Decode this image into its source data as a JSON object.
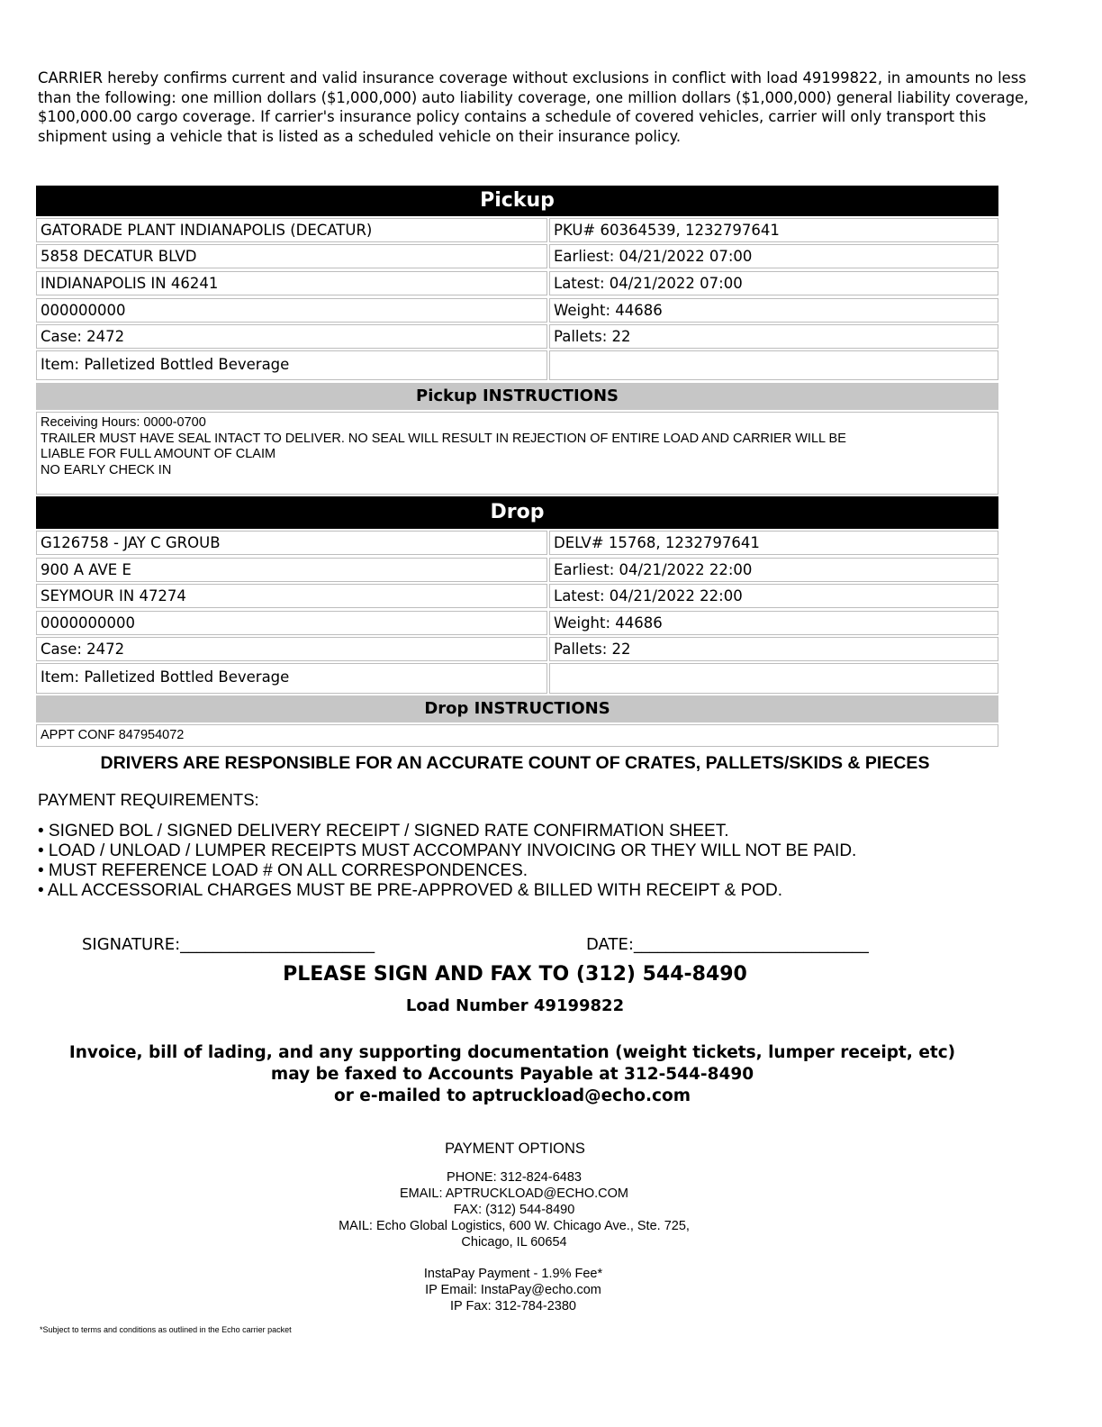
{
  "intro": [
    "CARRIER hereby confirms current and valid insurance coverage without exclusions in conflict with load 49199822, in amounts no less",
    "than the following: one million dollars ($1,000,000) auto liability coverage, one million dollars ($1,000,000) general liability coverage,",
    "$100,000.00 cargo coverage. If carrier's insurance policy contains a schedule of covered vehicles, carrier will only transport this",
    "shipment using a vehicle that is listed as a scheduled vehicle on their insurance policy."
  ],
  "pickup": {
    "title": "Pickup",
    "left": [
      "GATORADE PLANT INDIANAPOLIS (DECATUR)",
      "5858 DECATUR BLVD",
      "INDIANAPOLIS IN 46241",
      "000000000",
      "Case: 2472",
      "Item: Palletized Bottled Beverage"
    ],
    "right": [
      "PKU# 60364539, 1232797641",
      "Earliest: 04/21/2022 07:00",
      "Latest: 04/21/2022 07:00",
      "Weight: 44686",
      "Pallets: 22",
      ""
    ],
    "instructions_title": "Pickup INSTRUCTIONS",
    "instructions": [
      "Receiving Hours: 0000-0700",
      "TRAILER MUST HAVE SEAL INTACT TO DELIVER. NO SEAL WILL RESULT IN REJECTION OF ENTIRE LOAD AND CARRIER WILL BE",
      "LIABLE FOR FULL AMOUNT OF CLAIM",
      "NO EARLY CHECK IN"
    ]
  },
  "drop": {
    "title": "Drop",
    "left": [
      "G126758  -  JAY C GROUB",
      "900 A AVE E",
      "SEYMOUR IN 47274",
      "0000000000",
      "Case: 2472",
      "Item: Palletized Bottled Beverage"
    ],
    "right": [
      "DELV# 15768, 1232797641",
      "Earliest: 04/21/2022 22:00",
      "Latest: 04/21/2022 22:00",
      "Weight: 44686",
      "Pallets: 22",
      ""
    ],
    "instructions_title": "Drop INSTRUCTIONS",
    "instructions": [
      "APPT CONF 847954072"
    ]
  },
  "drivers_notice": "DRIVERS ARE RESPONSIBLE FOR AN ACCURATE COUNT OF CRATES, PALLETS/SKIDS & PIECES",
  "payment_requirements": {
    "title": "PAYMENT REQUIREMENTS:",
    "items": [
      "• SIGNED BOL / SIGNED DELIVERY RECEIPT / SIGNED RATE CONFIRMATION SHEET.",
      "• LOAD / UNLOAD / LUMPER RECEIPTS MUST ACCOMPANY INVOICING OR THEY WILL NOT BE PAID.",
      "• MUST REFERENCE LOAD # ON ALL CORRESPONDENCES.",
      "• ALL ACCESSORIAL CHARGES MUST BE PRE-APPROVED & BILLED WITH RECEIPT & POD."
    ]
  },
  "signature_label": "SIGNATURE:________________________",
  "date_label": "DATE:_____________________________",
  "fax_heading": "PLEASE SIGN AND FAX TO (312) 544-8490",
  "load_number": "Load Number 49199822",
  "invoice_lines": [
    "Invoice, bill of lading, and any supporting documentation (weight tickets, lumper receipt, etc)",
    "may be faxed to Accounts Payable at  312-544-8490",
    "or e-mailed to aptruckload@echo.com"
  ],
  "payment_options": {
    "title": "PAYMENT OPTIONS",
    "contact": [
      "PHONE: 312-824-6483",
      "EMAIL: APTRUCKLOAD@ECHO.COM",
      "FAX: (312) 544-8490",
      "MAIL: Echo Global Logistics, 600 W. Chicago Ave., Ste. 725,",
      "Chicago, IL 60654"
    ],
    "instapay": [
      "InstaPay Payment - 1.9% Fee*",
      "IP Email: InstaPay@echo.com",
      "IP Fax: 312-784-2380"
    ]
  },
  "footnote": "*Subject to terms and conditions as outlined in the Echo carrier packet"
}
